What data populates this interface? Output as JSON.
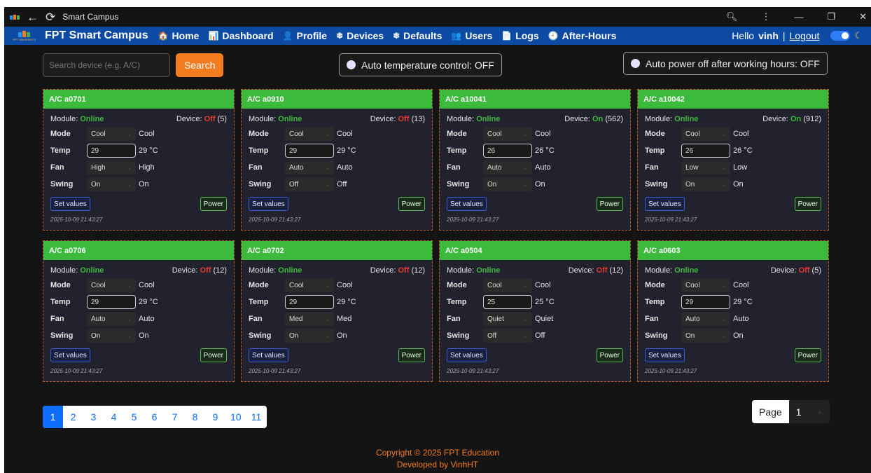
{
  "window": {
    "title": "Smart Campus"
  },
  "navbar": {
    "brand": "FPT Smart Campus",
    "logo_text": "FPT UNIVERSITY",
    "items": [
      {
        "label": "Home",
        "icon": "home-icon",
        "glyph": "🏠"
      },
      {
        "label": "Dashboard",
        "icon": "dashboard-icon",
        "glyph": "📊"
      },
      {
        "label": "Profile",
        "icon": "profile-icon",
        "glyph": "👤"
      },
      {
        "label": "Devices",
        "icon": "snowflake-icon",
        "glyph": "❄"
      },
      {
        "label": "Defaults",
        "icon": "snowflake-icon",
        "glyph": "❄"
      },
      {
        "label": "Users",
        "icon": "users-icon",
        "glyph": "👥"
      },
      {
        "label": "Logs",
        "icon": "logs-icon",
        "glyph": "📄"
      },
      {
        "label": "After-Hours",
        "icon": "clock-icon",
        "glyph": "🕘"
      }
    ],
    "greeting": "Hello",
    "username": "vinh",
    "separator": "|",
    "logout": "Logout"
  },
  "toolbar": {
    "search_placeholder": "Search device (e.g. A/C)",
    "search_label": "Search",
    "auto_temp_label": "Auto temperature control: OFF",
    "auto_power_label": "Auto power off after working hours: OFF"
  },
  "labels": {
    "module": "Module:",
    "device": "Device:",
    "mode": "Mode",
    "temp": "Temp",
    "fan": "Fan",
    "swing": "Swing",
    "set_values": "Set values",
    "power": "Power"
  },
  "devices": [
    {
      "name": "A/C a0701",
      "module": "Online",
      "device_state": "Off",
      "device_count": "(5)",
      "mode": "Cool",
      "temp": "29",
      "temp_display": "29 °C",
      "fan": "High",
      "swing": "On",
      "timestamp": "2025-10-09 21:43:27"
    },
    {
      "name": "A/C a0910",
      "module": "Online",
      "device_state": "Off",
      "device_count": "(13)",
      "mode": "Cool",
      "temp": "29",
      "temp_display": "29 °C",
      "fan": "Auto",
      "swing": "Off",
      "timestamp": "2025-10-09 21:43:27"
    },
    {
      "name": "A/C a10041",
      "module": "Online",
      "device_state": "On",
      "device_count": "(562)",
      "mode": "Cool",
      "temp": "26",
      "temp_display": "26 °C",
      "fan": "Auto",
      "swing": "On",
      "timestamp": "2025-10-09 21:43:27"
    },
    {
      "name": "A/C a10042",
      "module": "Online",
      "device_state": "On",
      "device_count": "(912)",
      "mode": "Cool",
      "temp": "26",
      "temp_display": "26 °C",
      "fan": "Low",
      "swing": "On",
      "timestamp": "2025-10-09 21:43:27"
    },
    {
      "name": "A/C a0706",
      "module": "Online",
      "device_state": "Off",
      "device_count": "(12)",
      "mode": "Cool",
      "temp": "29",
      "temp_display": "29 °C",
      "fan": "Auto",
      "swing": "On",
      "timestamp": "2025-10-09 21:43:27"
    },
    {
      "name": "A/C a0702",
      "module": "Online",
      "device_state": "Off",
      "device_count": "(12)",
      "mode": "Cool",
      "temp": "29",
      "temp_display": "29 °C",
      "fan": "Med",
      "swing": "On",
      "timestamp": "2025-10-09 21:43:27"
    },
    {
      "name": "A/C a0504",
      "module": "Online",
      "device_state": "Off",
      "device_count": "(12)",
      "mode": "Cool",
      "temp": "25",
      "temp_display": "25 °C",
      "fan": "Quiet",
      "swing": "Off",
      "timestamp": "2025-10-09 21:43:27"
    },
    {
      "name": "A/C a0603",
      "module": "Online",
      "device_state": "Off",
      "device_count": "(5)",
      "mode": "Cool",
      "temp": "29",
      "temp_display": "29 °C",
      "fan": "Auto",
      "swing": "On",
      "timestamp": "2025-10-09 21:43:27"
    }
  ],
  "pagination": {
    "pages": [
      "1",
      "2",
      "3",
      "4",
      "5",
      "6",
      "7",
      "8",
      "9",
      "10",
      "11"
    ],
    "active": "1",
    "page_label": "Page",
    "page_value": "1"
  },
  "footer": {
    "copyright": "Copyright © 2025 FPT Education",
    "developer": "Developed by VinhHT"
  },
  "colors": {
    "navbar": "#0d4aa4",
    "card_header": "#3cba3c",
    "accent_orange": "#f47c20",
    "off_red": "#e53935",
    "online_green": "#3cba3c"
  }
}
